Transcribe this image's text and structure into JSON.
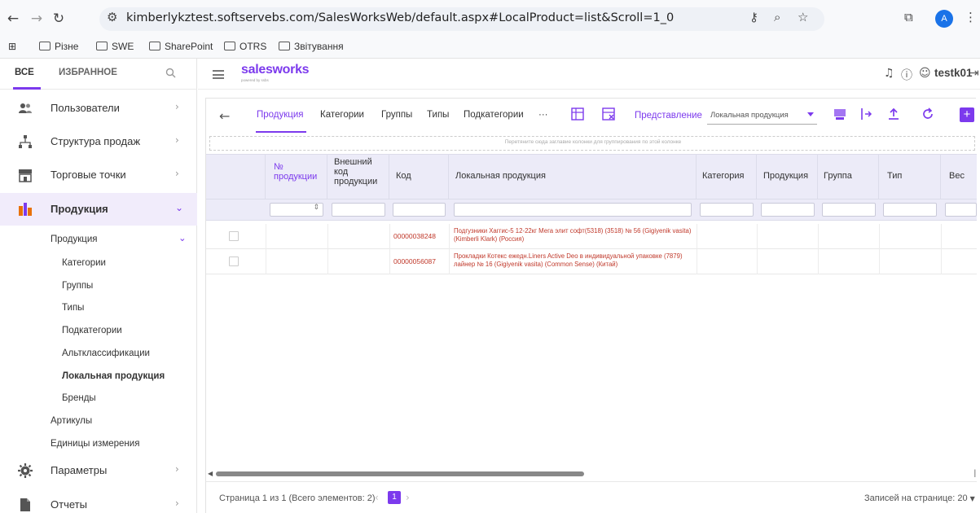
{
  "browser": {
    "url": "kimberlykztest.softservebs.com/SalesWorksWeb/default.aspx#LocalProduct=list&Scroll=1_0",
    "profile_initial": "A",
    "bookmarks": [
      "Різне",
      "SWE",
      "SharePoint",
      "OTRS",
      "Звітування"
    ]
  },
  "sidebar": {
    "tabs": [
      "ВСЕ",
      "ИЗБРАННОЕ"
    ],
    "items": [
      {
        "label": "Пользователи"
      },
      {
        "label": "Структура продаж"
      },
      {
        "label": "Торговые точки"
      },
      {
        "label": "Продукция"
      },
      {
        "label": "Параметры"
      },
      {
        "label": "Отчеты"
      }
    ],
    "sub_items": [
      "Продукция",
      "Категории",
      "Группы",
      "Типы",
      "Подкатегории",
      "Альтклассификации",
      "Локальная продукция",
      "Бренды",
      "Артикулы",
      "Единицы измерения"
    ]
  },
  "header": {
    "logo": "salesworks",
    "logo_sub": "powered by ssbs",
    "user": "testk01"
  },
  "toolbar": {
    "tabs": [
      "Продукция",
      "Категории",
      "Группы",
      "Типы",
      "Подкатегории",
      "···"
    ],
    "view_label": "Представление",
    "view_value": "Локальная продукция"
  },
  "grid": {
    "group_hint": "Перетяните сюда заглавие колонки для группирования по этой колонке",
    "columns": [
      "№ продукции",
      "Внешний код продукции",
      "Код",
      "Локальная продукция",
      "Категория",
      "Продукция",
      "Группа",
      "Тип",
      "Вес"
    ],
    "rows": [
      {
        "code": "00000038248",
        "name": "Подгузники Хаггис-5 12-22кг Мега элит софт(5318) (3518) № 56 (Gigiyenik vasita) (Kimberli Klark) (Россия)"
      },
      {
        "code": "00000056087",
        "name": "Прокладки Котекс ежедн.Liners Active Deo в индивидуальной упаковке (7879) лайнер № 16 (Gigiyenik vasita) (Common Sense) (Китай)"
      }
    ]
  },
  "pager": {
    "info": "Страница 1 из 1 (Всего элементов: 2)",
    "page": "1",
    "per_page_label": "Записей на странице:",
    "per_page_value": "20"
  },
  "colors": {
    "accent": "#7c3aed",
    "link_red": "#c0392b",
    "grid_header": "#ecebf8"
  }
}
